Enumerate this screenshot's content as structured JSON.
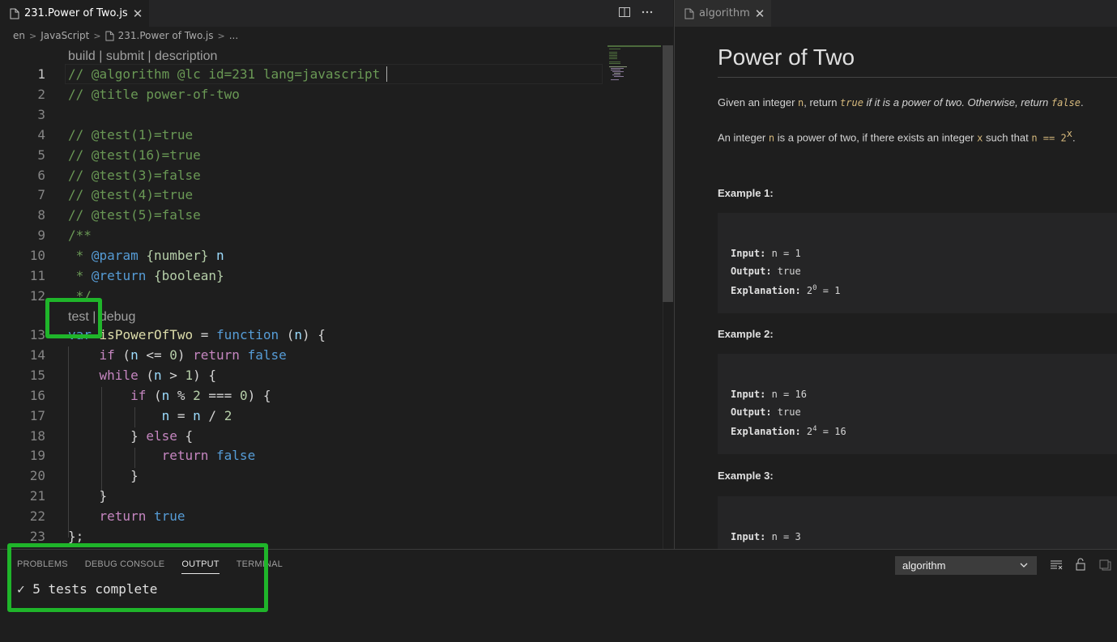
{
  "editor": {
    "tab": {
      "label": "231.Power of Two.js",
      "close": "✕"
    },
    "breadcrumb": [
      "en",
      "JavaScript",
      "231.Power of Two.js",
      "..."
    ],
    "lens_top": "build | submit | description",
    "lens_fn": {
      "test": "test",
      "sep": " | ",
      "debug": "debug"
    },
    "lines": [
      {
        "n": "1",
        "tokens": [
          {
            "t": "// @algorithm @lc id=231 lang=javascript",
            "c": "com"
          }
        ]
      },
      {
        "n": "2",
        "tokens": [
          {
            "t": "// @title power-of-two",
            "c": "com"
          }
        ]
      },
      {
        "n": "3",
        "tokens": []
      },
      {
        "n": "4",
        "tokens": [
          {
            "t": "// @test(1)=true",
            "c": "com"
          }
        ]
      },
      {
        "n": "5",
        "tokens": [
          {
            "t": "// @test(16)=true",
            "c": "com"
          }
        ]
      },
      {
        "n": "6",
        "tokens": [
          {
            "t": "// @test(3)=false",
            "c": "com"
          }
        ]
      },
      {
        "n": "7",
        "tokens": [
          {
            "t": "// @test(4)=true",
            "c": "com"
          }
        ]
      },
      {
        "n": "8",
        "tokens": [
          {
            "t": "// @test(5)=false",
            "c": "com"
          }
        ]
      },
      {
        "n": "9",
        "tokens": [
          {
            "t": "/**",
            "c": "com"
          }
        ]
      },
      {
        "n": "10",
        "tokens": [
          {
            "t": " * ",
            "c": "com"
          },
          {
            "t": "@param",
            "c": "kw"
          },
          {
            "t": " ",
            "c": "com"
          },
          {
            "t": "{number}",
            "c": "num"
          },
          {
            "t": " ",
            "c": "com"
          },
          {
            "t": "n",
            "c": "var"
          }
        ]
      },
      {
        "n": "11",
        "tokens": [
          {
            "t": " * ",
            "c": "com"
          },
          {
            "t": "@return",
            "c": "kw"
          },
          {
            "t": " ",
            "c": "com"
          },
          {
            "t": "{boolean}",
            "c": "num"
          }
        ]
      },
      {
        "n": "12",
        "tokens": [
          {
            "t": " */",
            "c": "com"
          }
        ]
      },
      {
        "n": "13",
        "tokens": [
          {
            "t": "var",
            "c": "kw"
          },
          {
            "t": " ",
            "c": "txt"
          },
          {
            "t": "isPowerOfTwo",
            "c": "fn"
          },
          {
            "t": " = ",
            "c": "txt"
          },
          {
            "t": "function",
            "c": "kw"
          },
          {
            "t": " (",
            "c": "txt"
          },
          {
            "t": "n",
            "c": "var"
          },
          {
            "t": ") {",
            "c": "txt"
          }
        ]
      },
      {
        "n": "14",
        "tokens": [
          {
            "t": "    ",
            "c": "txt"
          },
          {
            "t": "if",
            "c": "ctl"
          },
          {
            "t": " (",
            "c": "txt"
          },
          {
            "t": "n",
            "c": "var"
          },
          {
            "t": " <= ",
            "c": "txt"
          },
          {
            "t": "0",
            "c": "num"
          },
          {
            "t": ") ",
            "c": "txt"
          },
          {
            "t": "return",
            "c": "ctl"
          },
          {
            "t": " ",
            "c": "txt"
          },
          {
            "t": "false",
            "c": "kw"
          }
        ]
      },
      {
        "n": "15",
        "tokens": [
          {
            "t": "    ",
            "c": "txt"
          },
          {
            "t": "while",
            "c": "ctl"
          },
          {
            "t": " (",
            "c": "txt"
          },
          {
            "t": "n",
            "c": "var"
          },
          {
            "t": " > ",
            "c": "txt"
          },
          {
            "t": "1",
            "c": "num"
          },
          {
            "t": ") {",
            "c": "txt"
          }
        ]
      },
      {
        "n": "16",
        "tokens": [
          {
            "t": "        ",
            "c": "txt"
          },
          {
            "t": "if",
            "c": "ctl"
          },
          {
            "t": " (",
            "c": "txt"
          },
          {
            "t": "n",
            "c": "var"
          },
          {
            "t": " % ",
            "c": "txt"
          },
          {
            "t": "2",
            "c": "num"
          },
          {
            "t": " === ",
            "c": "txt"
          },
          {
            "t": "0",
            "c": "num"
          },
          {
            "t": ") {",
            "c": "txt"
          }
        ]
      },
      {
        "n": "17",
        "tokens": [
          {
            "t": "            ",
            "c": "txt"
          },
          {
            "t": "n",
            "c": "var"
          },
          {
            "t": " = ",
            "c": "txt"
          },
          {
            "t": "n",
            "c": "var"
          },
          {
            "t": " / ",
            "c": "txt"
          },
          {
            "t": "2",
            "c": "num"
          }
        ]
      },
      {
        "n": "18",
        "tokens": [
          {
            "t": "        } ",
            "c": "txt"
          },
          {
            "t": "else",
            "c": "ctl"
          },
          {
            "t": " {",
            "c": "txt"
          }
        ]
      },
      {
        "n": "19",
        "tokens": [
          {
            "t": "            ",
            "c": "txt"
          },
          {
            "t": "return",
            "c": "ctl"
          },
          {
            "t": " ",
            "c": "txt"
          },
          {
            "t": "false",
            "c": "kw"
          }
        ]
      },
      {
        "n": "20",
        "tokens": [
          {
            "t": "        }",
            "c": "txt"
          }
        ]
      },
      {
        "n": "21",
        "tokens": [
          {
            "t": "    }",
            "c": "txt"
          }
        ]
      },
      {
        "n": "22",
        "tokens": [
          {
            "t": "    ",
            "c": "txt"
          },
          {
            "t": "return",
            "c": "ctl"
          },
          {
            "t": " ",
            "c": "txt"
          },
          {
            "t": "true",
            "c": "kw"
          }
        ]
      },
      {
        "n": "23",
        "tokens": [
          {
            "t": "};",
            "c": "txt"
          }
        ]
      }
    ]
  },
  "preview": {
    "tab": {
      "label": "algorithm",
      "close": "✕"
    },
    "title": "Power of Two",
    "para1": {
      "a": "Given an integer ",
      "n": "n",
      "b": ", return ",
      "true": "true",
      "c": " if it is a power of two. Otherwise, return ",
      "false": "false",
      "d": "."
    },
    "para2": {
      "a": "An integer ",
      "n": "n",
      "b": " is a power of two, if there exists an integer ",
      "x": "x",
      "c": " such that ",
      "expr": "n == 2",
      "sup": "x",
      "d": "."
    },
    "examples": [
      {
        "title": "Example 1:",
        "input_label": "Input:",
        "input": " n = 1",
        "output_label": "Output:",
        "output": " true",
        "expl_label": "Explanation:",
        "expl_base": " 2",
        "expl_sup": "0",
        "expl_rest": " = 1"
      },
      {
        "title": "Example 2:",
        "input_label": "Input:",
        "input": " n = 16",
        "output_label": "Output:",
        "output": " true",
        "expl_label": "Explanation:",
        "expl_base": " 2",
        "expl_sup": "4",
        "expl_rest": " = 16"
      },
      {
        "title": "Example 3:",
        "input_label": "Input:",
        "input": " n = 3"
      }
    ]
  },
  "panel": {
    "tabs": [
      "PROBLEMS",
      "DEBUG CONSOLE",
      "OUTPUT",
      "TERMINAL"
    ],
    "active_tab": "OUTPUT",
    "output": "✓ 5 tests complete",
    "channel": "algorithm"
  },
  "colors": {
    "highlight": "#1fb52a",
    "accent": "#e7e7e7"
  }
}
